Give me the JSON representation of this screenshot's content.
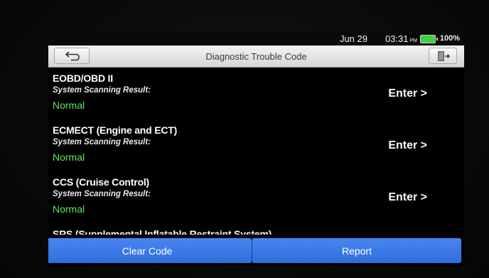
{
  "status_bar": {
    "date": "Jun 29",
    "time": "03:31",
    "ampm": "PM",
    "battery_pct": "100%",
    "battery_color": "#3fd13f"
  },
  "title_bar": {
    "title": "Diagnostic Trouble Code",
    "back_icon": "back-arrow-icon",
    "exit_icon": "exit-door-icon"
  },
  "systems": [
    {
      "name": "EOBD/OBD II",
      "result_label": "System Scanning Result:",
      "result": "Normal",
      "action": "Enter >"
    },
    {
      "name": "ECMECT (Engine and ECT)",
      "result_label": "System Scanning Result:",
      "result": "Normal",
      "action": "Enter >"
    },
    {
      "name": "CCS (Cruise Control)",
      "result_label": "System Scanning Result:",
      "result": "Normal",
      "action": "Enter >"
    },
    {
      "name": "SRS (Supplemental Inflatable Restraint System)"
    }
  ],
  "footer": {
    "clear_code_label": "Clear Code",
    "report_label": "Report",
    "button_color": "#3a78ea"
  }
}
